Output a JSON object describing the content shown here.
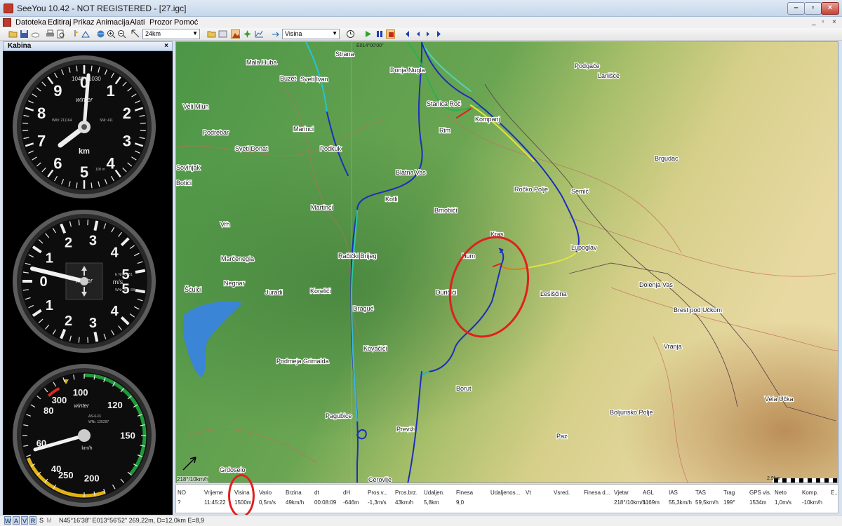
{
  "window": {
    "title": "SeeYou 10.42 - NOT REGISTERED - [27.igc]"
  },
  "menu": {
    "items": [
      "Datoteka",
      "Editiraj",
      "Prikaz",
      "Animacija",
      "Alati",
      "Prozor",
      "Pomoć"
    ],
    "mdi_controls": [
      "_",
      "▫",
      "×"
    ]
  },
  "toolbar": {
    "scale_value": "24km",
    "variable_value": "Visina"
  },
  "panel": {
    "title": "Kabina",
    "close": "×"
  },
  "altimeter": {
    "numbers": [
      "0",
      "1",
      "2",
      "3",
      "4",
      "5",
      "6",
      "7",
      "8",
      "9"
    ],
    "unit": "km",
    "small_top": [
      "1040",
      "1030"
    ],
    "brand": "winter",
    "serial_left": "WIN: 211164",
    "serial_right": "SNI: 411",
    "mult": "100 m"
  },
  "vario": {
    "upper_numbers": [
      "1",
      "2",
      "3",
      "4",
      "5"
    ],
    "lower_numbers": [
      "1",
      "2",
      "3",
      "4",
      "5"
    ],
    "zero": "0",
    "brand": "winter",
    "unit": "m/s",
    "serial_1": "E Nr.05251",
    "serial_2": "WNr. 851.5B"
  },
  "asi": {
    "numbers": [
      "40",
      "60",
      "80",
      "100",
      "120",
      "150",
      "200",
      "250",
      "300"
    ],
    "brand": "winter",
    "unit": "km/h",
    "serial_1": "AS-6-01",
    "serial_2": "WNr. 125297"
  },
  "map": {
    "coordinate_label": "E014°00'00\"",
    "wind_label": "218°/10km/h",
    "scale_label": "2.9km",
    "places": [
      {
        "name": "Strana"
      },
      {
        "name": "Mala Huba"
      },
      {
        "name": "Buzet"
      },
      {
        "name": "Sveti Ivan"
      },
      {
        "name": "Donja Nugla"
      },
      {
        "name": "Podgače"
      },
      {
        "name": "Lanišće"
      },
      {
        "name": "Veli Mlun"
      },
      {
        "name": "Stanica Roč"
      },
      {
        "name": "Kompanj"
      },
      {
        "name": "Podrebar"
      },
      {
        "name": "Marinci"
      },
      {
        "name": "Rim"
      },
      {
        "name": "Sveti Donat"
      },
      {
        "name": "Podkuk"
      },
      {
        "name": "Brgudac"
      },
      {
        "name": "Sovinjak"
      },
      {
        "name": "Blatna Vas"
      },
      {
        "name": "Botići"
      },
      {
        "name": "Kotli"
      },
      {
        "name": "Ročko Polje"
      },
      {
        "name": "Semić"
      },
      {
        "name": "Martinci"
      },
      {
        "name": "Brnobići"
      },
      {
        "name": "Vrh"
      },
      {
        "name": "Kras"
      },
      {
        "name": "Lupoglav"
      },
      {
        "name": "Marčenegla"
      },
      {
        "name": "Račički Brijeg"
      },
      {
        "name": "Hum"
      },
      {
        "name": "Negnar"
      },
      {
        "name": "Dolenja Vas"
      },
      {
        "name": "Šćulci"
      },
      {
        "name": "Juradi"
      },
      {
        "name": "Korelići"
      },
      {
        "name": "Duričići"
      },
      {
        "name": "Lesiščina"
      },
      {
        "name": "Dragué"
      },
      {
        "name": "Brest pod Učkom"
      },
      {
        "name": "Kovačići"
      },
      {
        "name": "Vranja"
      },
      {
        "name": "Podmeja Grimalda"
      },
      {
        "name": "Borut"
      },
      {
        "name": "Vela Učka"
      },
      {
        "name": "Boljunsko Polje"
      },
      {
        "name": "Pagubice"
      },
      {
        "name": "Previž"
      },
      {
        "name": "Paz"
      },
      {
        "name": "Grdoselo"
      },
      {
        "name": "Cerovlje"
      }
    ]
  },
  "data_bar": {
    "columns": [
      {
        "header": "NO",
        "value": "?"
      },
      {
        "header": "Vrijeme",
        "value": "11:45:22"
      },
      {
        "header": "Visina",
        "value": "1500m"
      },
      {
        "header": "Vario",
        "value": "0,5m/s"
      },
      {
        "header": "Brzina",
        "value": "49km/h"
      },
      {
        "header": "dt",
        "value": "00:08:09"
      },
      {
        "header": "dH",
        "value": "-646m"
      },
      {
        "header": "Pros.v...",
        "value": "-1,3m/s"
      },
      {
        "header": "Pros.brz.",
        "value": "43km/h"
      },
      {
        "header": "Udaljen.",
        "value": "5,8km"
      },
      {
        "header": "Finesa",
        "value": "9,0"
      },
      {
        "header": "Udaljenos...",
        "value": ""
      },
      {
        "header": "Vt",
        "value": ""
      },
      {
        "header": "Vsred.",
        "value": ""
      },
      {
        "header": "Finesa d...",
        "value": ""
      },
      {
        "header": "Vjetar",
        "value": "218°/10km/h"
      },
      {
        "header": "AGL",
        "value": "1169m"
      },
      {
        "header": "IAS",
        "value": "55,3km/h"
      },
      {
        "header": "TAS",
        "value": "59,5km/h"
      },
      {
        "header": "Trag",
        "value": "199°"
      },
      {
        "header": "GPS vis.",
        "value": "1534m"
      },
      {
        "header": "Neto",
        "value": "1,0m/s"
      },
      {
        "header": "Komp.",
        "value": "-10km/h"
      },
      {
        "header": "E..",
        "value": ""
      }
    ]
  },
  "status_bar": {
    "tabs": [
      "W",
      "A",
      "V",
      "R",
      "S",
      "M"
    ],
    "coordinates": "N45°16'38\" E013°56'52\" 269,22m, D=12,0km E=8,9"
  },
  "colors": {
    "terrain_low": "#4f9a49",
    "terrain_high": "#e6d49c",
    "track_blue": "#1d2fb8",
    "annotation_red": "#e0201d",
    "lake": "#3a85d6"
  }
}
